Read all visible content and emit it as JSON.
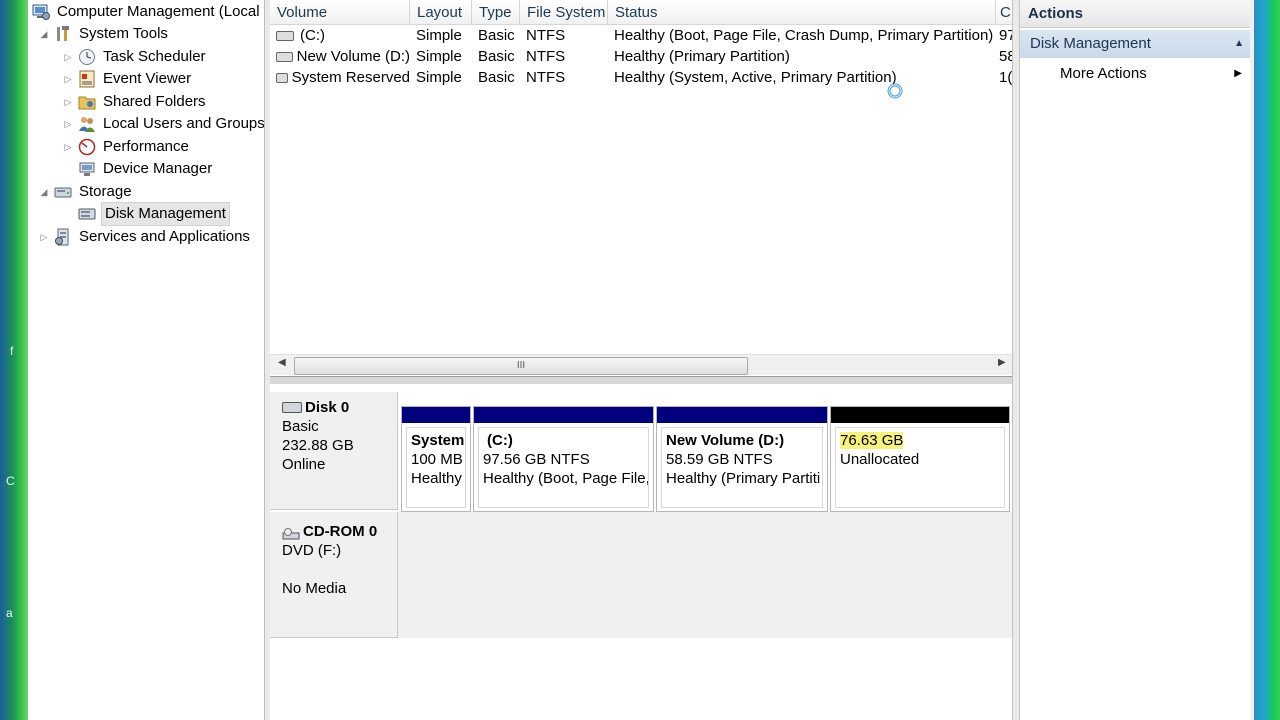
{
  "tree": {
    "root": "Computer Management (Local",
    "items": [
      {
        "label": "System Tools",
        "icon": "tools-icon",
        "expander": "◢"
      },
      {
        "label": "Task Scheduler",
        "icon": "clock-icon",
        "expander": "▷"
      },
      {
        "label": "Event Viewer",
        "icon": "event-viewer-icon",
        "expander": "▷"
      },
      {
        "label": "Shared Folders",
        "icon": "shared-folder-icon",
        "expander": "▷"
      },
      {
        "label": "Local Users and Groups",
        "icon": "users-icon",
        "expander": "▷"
      },
      {
        "label": "Performance",
        "icon": "performance-icon",
        "expander": "▷"
      },
      {
        "label": "Device Manager",
        "icon": "device-manager-icon",
        "expander": ""
      },
      {
        "label": "Storage",
        "icon": "storage-icon",
        "expander": "◢"
      },
      {
        "label": "Disk Management",
        "icon": "disk-icon",
        "expander": ""
      },
      {
        "label": "Services and Applications",
        "icon": "services-icon",
        "expander": "▷"
      }
    ]
  },
  "columns": [
    "Volume",
    "Layout",
    "Type",
    "File System",
    "Status",
    "C"
  ],
  "volumes": [
    {
      "volume": "(C:)",
      "layout": "Simple",
      "type": "Basic",
      "fs": "NTFS",
      "status": "Healthy (Boot, Page File, Crash Dump, Primary Partition)",
      "cap": "97"
    },
    {
      "volume": "New Volume (D:)",
      "layout": "Simple",
      "type": "Basic",
      "fs": "NTFS",
      "status": "Healthy (Primary Partition)",
      "cap": "58"
    },
    {
      "volume": "System Reserved",
      "layout": "Simple",
      "type": "Basic",
      "fs": "NTFS",
      "status": "Healthy (System, Active, Primary Partition)",
      "cap": "1("
    }
  ],
  "scrollbar": {
    "thumb_grip": "III"
  },
  "disk0": {
    "name": "Disk 0",
    "type": "Basic",
    "size": "232.88 GB",
    "state": "Online",
    "partitions": [
      {
        "name": "System",
        "size": "100 MB",
        "status": "Healthy"
      },
      {
        "name": "(C:)",
        "size": "97.56 GB NTFS",
        "status": "Healthy (Boot, Page File,"
      },
      {
        "name": "New Volume  (D:)",
        "size": "58.59 GB NTFS",
        "status": "Healthy (Primary Partiti"
      },
      {
        "name": "",
        "size": "76.63 GB",
        "status": "Unallocated"
      }
    ]
  },
  "cdrom0": {
    "name": "CD-ROM 0",
    "type": "DVD (F:)",
    "state": "No Media"
  },
  "actions": {
    "title": "Actions",
    "section": "Disk Management",
    "section_arrow": "▲",
    "more": "More Actions",
    "more_arrow": "▶"
  },
  "colors": {
    "partition_bar": "#00007f",
    "unallocated_bar": "#000000",
    "section_bg": "#c9d8ea"
  }
}
